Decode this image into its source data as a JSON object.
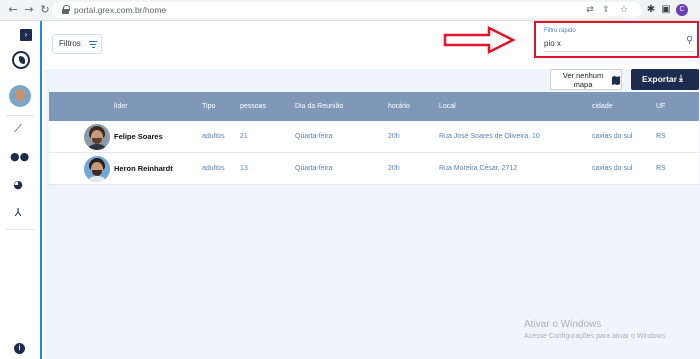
{
  "browser": {
    "url": "portal.grex.com.br/home",
    "back_icon": "arrow-left-icon",
    "forward_icon": "arrow-right-icon",
    "reload_icon": "reload-icon",
    "profile_initial": "C"
  },
  "sidebar": {
    "expand_icon": "chevron-right-icon",
    "items": [
      {
        "name": "trend-icon",
        "glyph": "⟋"
      },
      {
        "name": "people-icon",
        "glyph": "👥"
      },
      {
        "name": "pie-chart-icon",
        "glyph": "◕"
      },
      {
        "name": "network-icon",
        "glyph": "⅄"
      }
    ],
    "info_label": "i"
  },
  "toolbar": {
    "filters_label": "Filtros",
    "quick_filter": {
      "label": "Filtro rápido",
      "value": "pio x"
    },
    "map_button_label": "Ver nenhum mapa",
    "export_button_label": "Exportar"
  },
  "table": {
    "columns": [
      "líder",
      "Tipo",
      "pessoas",
      "Dia da Reunião",
      "horário",
      "Local",
      "cidade",
      "UF"
    ],
    "rows": [
      {
        "leader": "Felipe Soares",
        "type": "adultos",
        "people": "21",
        "day": "Quarta-feira",
        "time": "20h",
        "location": "Rua José Soares de Oliveira, 10",
        "city": "caxias do sul",
        "state": "RS"
      },
      {
        "leader": "Heron Reinhardt",
        "type": "adultos",
        "people": "13",
        "day": "Quarta-feira",
        "time": "20h",
        "location": "Rua Moreira César, 2712",
        "city": "caxias do sul",
        "state": "RS"
      }
    ]
  },
  "watermark": {
    "title": "Ativar o Windows",
    "subtitle": "Acesse Configurações para ativar o Windows."
  },
  "colors": {
    "annotation_red": "#e0142a",
    "navy": "#1d2b4f",
    "table_header": "#7f97b9",
    "accent_blue": "#2f80ed"
  }
}
